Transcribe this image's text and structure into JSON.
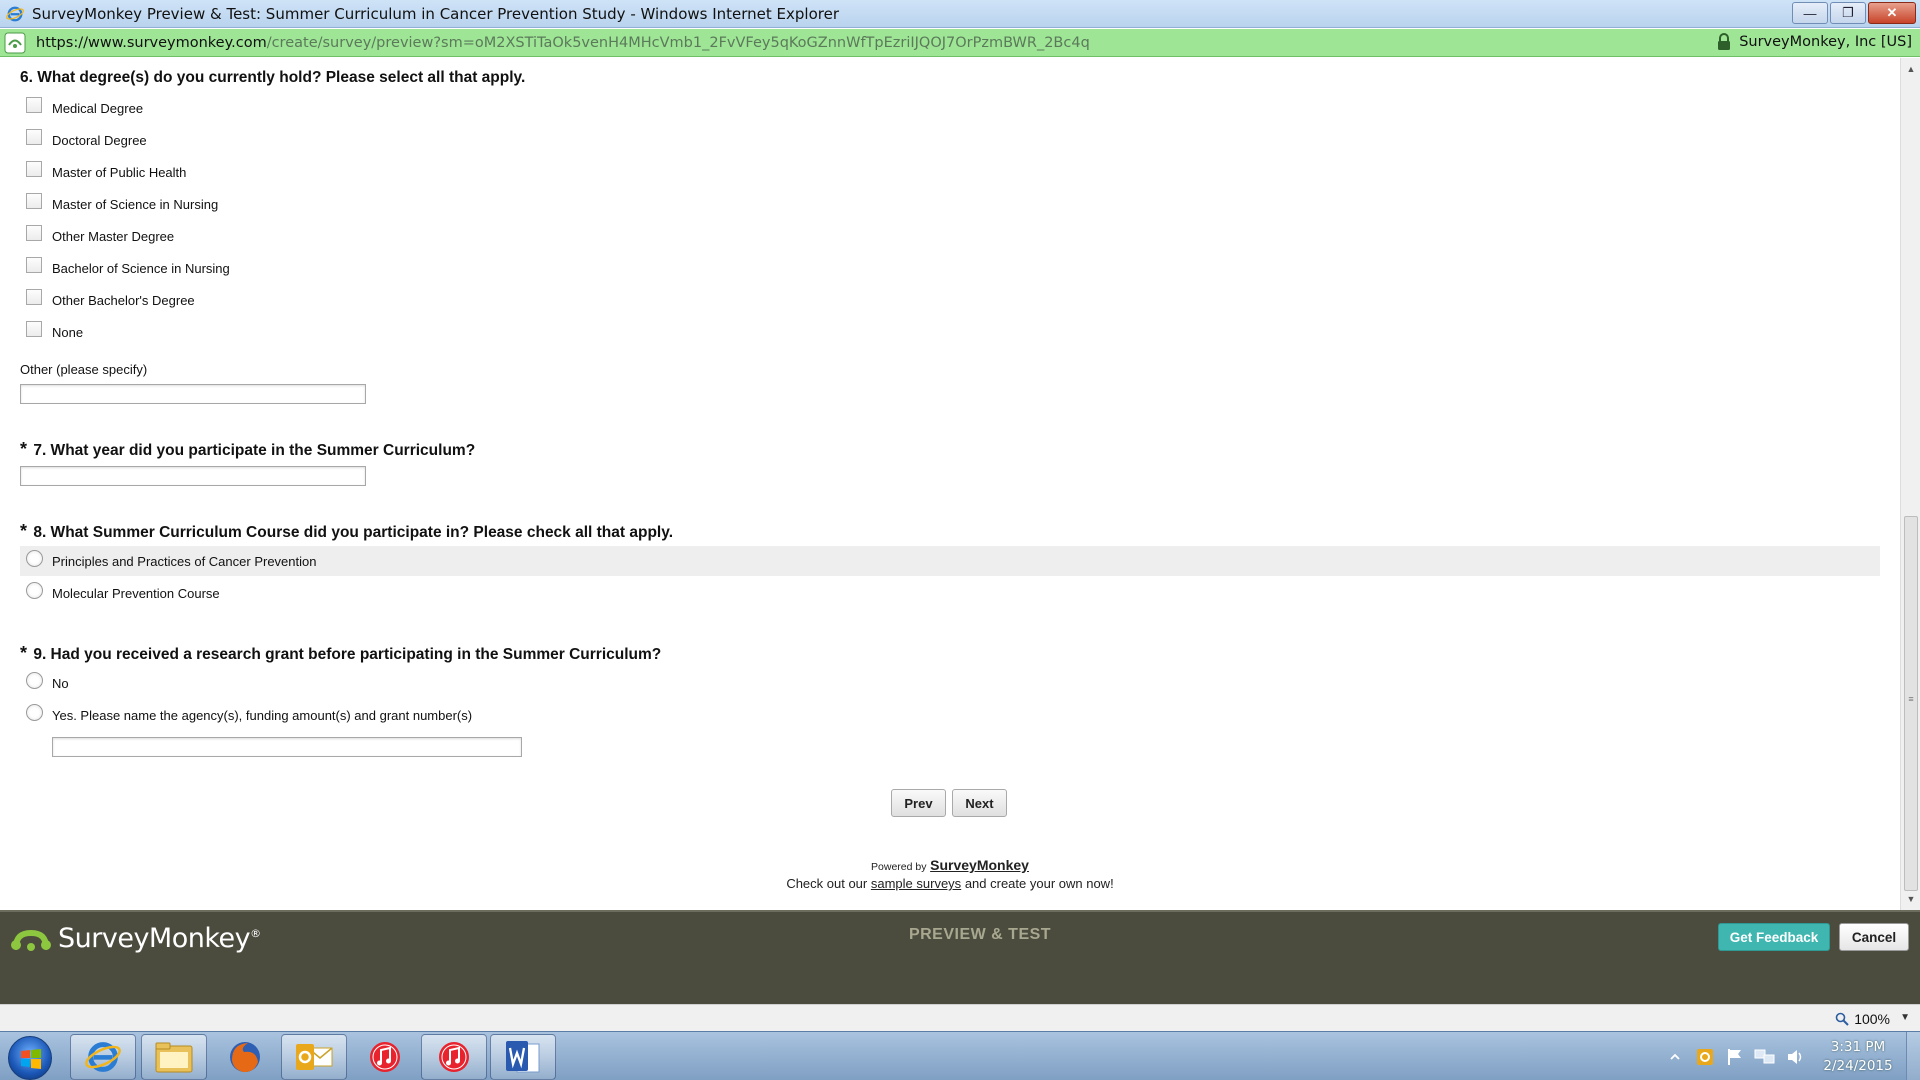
{
  "window": {
    "title": "SurveyMonkey Preview & Test: Summer Curriculum in Cancer Prevention Study - Windows Internet Explorer",
    "minimize": "—",
    "restore": "❐",
    "close": "✕"
  },
  "address": {
    "host": "https://www.surveymonkey.com",
    "path": "/create/survey/preview?sm=oM2XSTiTaOk5venH4MHcVmb1_2FvVFey5qKoGZnnWfTpEzriIJQOJ7OrPzmBWR_2Bc4q",
    "cert_label": "SurveyMonkey, Inc [US]"
  },
  "survey": {
    "q6": {
      "number_text": "6. What degree(s) do you currently hold? Please select all that apply.",
      "options": [
        "Medical Degree",
        "Doctoral Degree",
        "Master of Public Health",
        "Master of Science in Nursing",
        "Other Master Degree",
        "Bachelor of Science in Nursing",
        "Other Bachelor's Degree",
        "None"
      ],
      "other_label": "Other (please specify)",
      "other_value": ""
    },
    "q7": {
      "required_mark": "*",
      "number_text": "7. What year did you participate in the Summer Curriculum?",
      "value": ""
    },
    "q8": {
      "required_mark": "*",
      "number_text": "8. What Summer Curriculum Course did you participate in? Please check all that apply.",
      "options": [
        "Principles and Practices of Cancer Prevention",
        "Molecular Prevention Course"
      ]
    },
    "q9": {
      "required_mark": "*",
      "number_text": "9. Had you received a research grant before participating in the Summer Curriculum?",
      "options": [
        "No",
        "Yes. Please name the agency(s), funding amount(s) and grant number(s)"
      ],
      "yes_value": ""
    },
    "nav": {
      "prev": "Prev",
      "next": "Next"
    },
    "footer": {
      "powered_by": "Powered by",
      "brand": "SurveyMonkey",
      "check_out": "Check out our",
      "sample_link": "sample surveys",
      "rest": "and create your own now!"
    }
  },
  "preview_bar": {
    "logo_text": "SurveyMonkey",
    "logo_reg": "®",
    "mode_label": "PREVIEW & TEST",
    "feedback_button": "Get Feedback",
    "cancel_button": "Cancel"
  },
  "status": {
    "zoom": "100%"
  },
  "taskbar": {
    "time": "3:31 PM",
    "date": "2/24/2015"
  },
  "colors": {
    "address_bg": "#9ee596",
    "preview_bar_bg": "#4b4b3e",
    "feedback_button": "#3fb6b0",
    "logo_green": "#8dc63f"
  }
}
